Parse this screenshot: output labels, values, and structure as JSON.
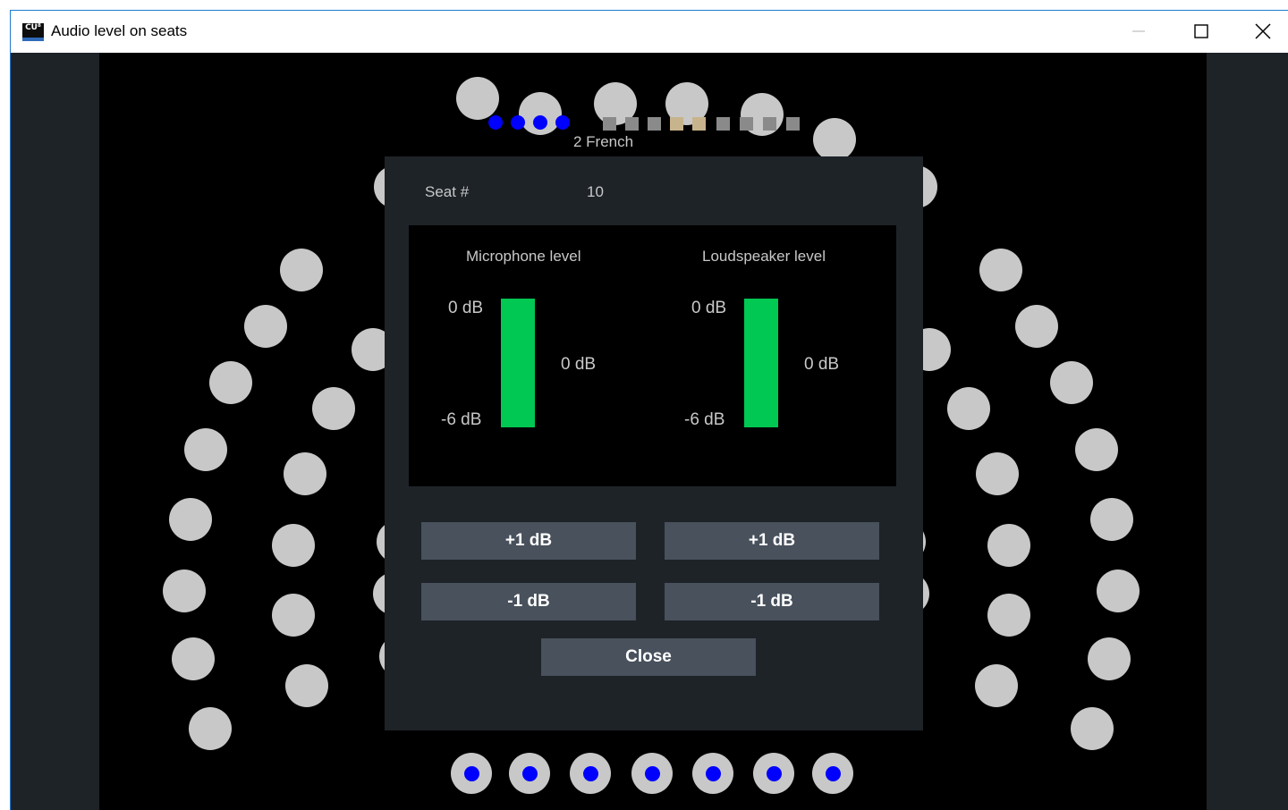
{
  "window": {
    "title": "Audio level on seats",
    "icon_text": "CU⁸",
    "controls": [
      "minimize-icon",
      "maximize-icon",
      "close-icon"
    ]
  },
  "stage": {
    "language_label": "2 French"
  },
  "dialog": {
    "seat_label": "Seat #",
    "seat_value": "10",
    "microphone": {
      "title": "Microphone level",
      "scale_top": "0 dB",
      "scale_bottom": "-6 dB",
      "current": "0 dB",
      "level_fraction": 1.0,
      "increase_label": "+1 dB",
      "decrease_label": "-1 dB"
    },
    "loudspeaker": {
      "title": "Loudspeaker level",
      "scale_top": "0 dB",
      "scale_bottom": "-6 dB",
      "current": "0 dB",
      "level_fraction": 1.0,
      "increase_label": "+1 dB",
      "decrease_label": "-1 dB"
    },
    "close_label": "Close"
  },
  "colors": {
    "level_bar": "#00c853",
    "active_seat_dot": "#0000ff",
    "seat": "#c8c8c8",
    "button": "#48515c"
  }
}
